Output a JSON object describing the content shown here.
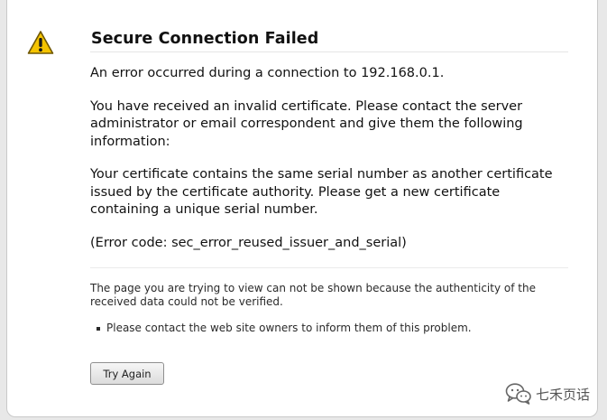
{
  "error": {
    "title": "Secure Connection Failed",
    "paragraphs": [
      "An error occurred during a connection to 192.168.0.1.",
      "You have received an invalid certificate.  Please contact the server administrator or email correspondent and give them the following information:",
      "Your certificate contains the same serial number as another certificate issued by the certificate authority.  Please get a new certificate containing a unique serial number.",
      "(Error code: sec_error_reused_issuer_and_serial)"
    ],
    "short_desc": "The page you are trying to view can not be shown because the authenticity of the received data could not be verified.",
    "advice": [
      "Please contact the web site owners to inform them of this problem."
    ],
    "try_again_label": "Try Again"
  },
  "watermark": {
    "text": "七禾页话",
    "icon": "wechat-icon"
  },
  "colors": {
    "warning_fill": "#f5c400",
    "warning_border": "#8a6d00"
  }
}
